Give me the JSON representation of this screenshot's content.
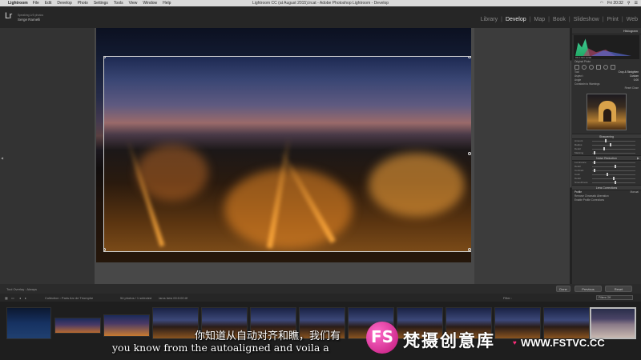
{
  "menubar": {
    "app": "Lightroom",
    "items": [
      "File",
      "Edit",
      "Develop",
      "Photo",
      "Settings",
      "Tools",
      "View",
      "Window",
      "Help"
    ],
    "window_title": "Lightroom CC (at August 2015).lrcat - Adobe Photoshop Lightroom - Develop",
    "clock": "Fri 20:32"
  },
  "identity": {
    "logo": "Lr",
    "line1": "Speaking Lr5 photos",
    "line2": "Serge Ramelli"
  },
  "modules": {
    "library": "Library",
    "develop": "Develop",
    "map": "Map",
    "book": "Book",
    "slideshow": "Slideshow",
    "print": "Print",
    "web": "Web",
    "separator": "|"
  },
  "right_panel": {
    "histogram_label": "Histogram",
    "histogram_values": "f/5.6 ISO 1/200",
    "original_photo": "Original Photo",
    "tool": "Tool",
    "crop_label": "Crop & Straighten",
    "aspect_label": "Aspect :",
    "aspect_value": "Custom",
    "angle_label": "Angle",
    "angle_value": "0.00",
    "constrain": "Constrain to Warnings",
    "reset": "Reset",
    "close": "Close",
    "sharpening_label": "Sharpening",
    "noise_reduction_label": "Noise Reduction",
    "lens_corrections_label": "Lens Corrections",
    "profile_tab": "Profile",
    "manual_tab": "Manual",
    "enable_profile": "Enable Profile Corrections",
    "remove_ca": "Remove Chromatic Aberration",
    "slider_labels": [
      "Amount",
      "Radius",
      "Detail",
      "Masking",
      "Luminance",
      "Detail",
      "Contrast",
      "Color",
      "Detail",
      "Smoothness"
    ]
  },
  "toolbar": {
    "tool_overlay": "Tool Overlay :",
    "tool_overlay_value": "Always",
    "done": "Done",
    "previous": "Previous",
    "reset": "Reset"
  },
  "filmstrip_bar": {
    "collection": "Collection : Paris Arc de Triomphe",
    "count": "54 photos / 1 selected",
    "filename": "/arcs bew 00:0:00.tif",
    "filter_label": "Filter :",
    "filter_value": "Filters Off"
  },
  "subtitles": {
    "chinese": "你知道从自动对齐和瞧，我们有",
    "english": "you know from the autoaligned and voila a"
  },
  "watermark": {
    "logo": "FS",
    "name": "梵摄创意库",
    "url": "WWW.FSTVC.CC",
    "heart": "♥"
  },
  "colors": {
    "accent": "#ff2d7a",
    "panel": "#2f2f2f",
    "background": "#3c3c3c"
  }
}
